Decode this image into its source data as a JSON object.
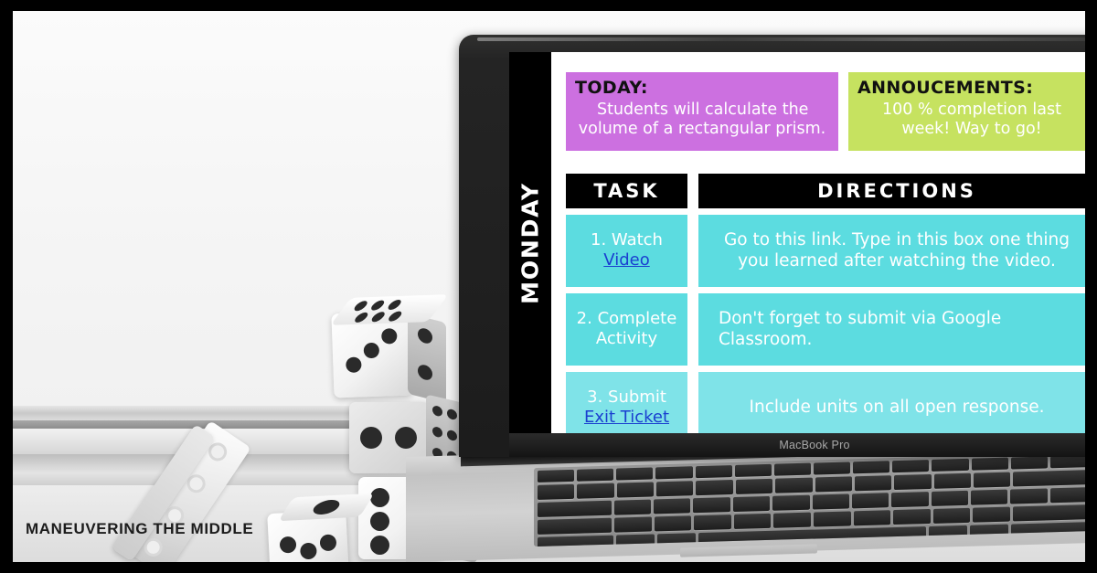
{
  "watermark": "MANEUVERING THE MIDDLE",
  "laptop": {
    "model_label": "MacBook Pro"
  },
  "screen": {
    "day_label": "MONDAY",
    "colors": {
      "today_box": "#cc70e0",
      "announcements_box": "#c6e260",
      "row_cyan": "#5cdce0",
      "row_cyan_light": "#7fe3e8",
      "header_black": "#000000",
      "link_blue": "#1a3fd0"
    },
    "today": {
      "heading": "TODAY:",
      "line1": "Students will calculate the",
      "line2": "volume of a rectangular prism."
    },
    "announcements": {
      "heading": "ANNOUCEMENTS:",
      "line1": "100 % completion last week! Way",
      "line2": "to go!"
    },
    "table": {
      "headers": {
        "task": "TASK",
        "directions": "DIRECTIONS"
      },
      "rows": [
        {
          "task_prefix": "1. Watch",
          "task_link": "Video",
          "task_suffix": "",
          "directions": "Go to this link. Type in this box one thing you learned after watching the video.",
          "dir_align": "center"
        },
        {
          "task_prefix": "2. Complete Activity",
          "task_link": "",
          "task_suffix": "",
          "directions": "Don't forget to submit via Google Classroom.",
          "dir_align": "left"
        },
        {
          "task_prefix": "3. Submit ",
          "task_link": "Exit Ticket",
          "task_suffix": "",
          "directions": "Include units on all open response.",
          "dir_align": "center"
        }
      ]
    }
  }
}
